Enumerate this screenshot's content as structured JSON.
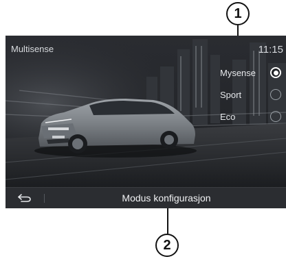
{
  "callouts": {
    "top": "1",
    "bottom": "2"
  },
  "header": {
    "title": "Multisense",
    "time": "11:15"
  },
  "modes": [
    {
      "label": "Mysense",
      "selected": true
    },
    {
      "label": "Sport",
      "selected": false
    },
    {
      "label": "Eco",
      "selected": false
    }
  ],
  "bottom_bar": {
    "back_icon": "back-arrow-icon",
    "config_label": "Modus konfigurasjon"
  }
}
